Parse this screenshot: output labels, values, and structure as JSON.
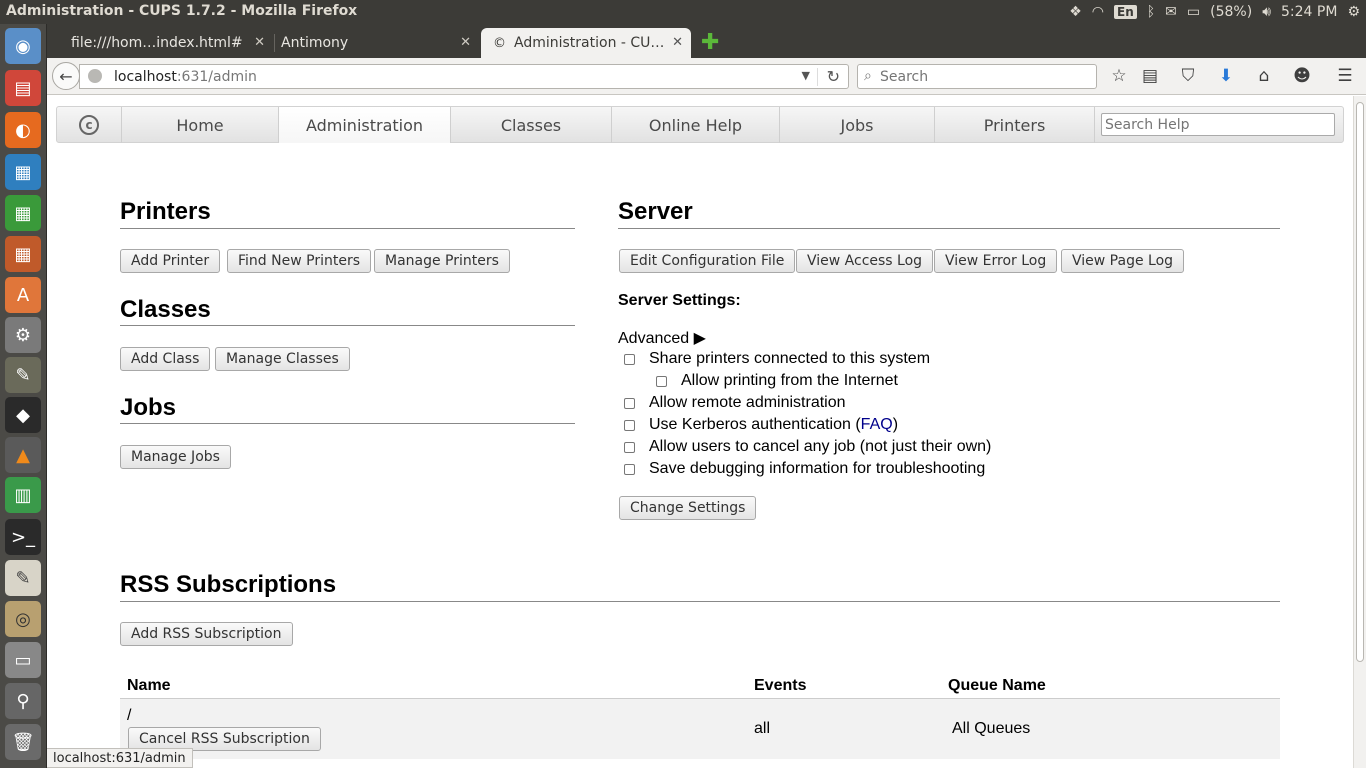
{
  "window": {
    "title": "Administration - CUPS 1.7.2 - Mozilla Firefox"
  },
  "tray": {
    "keyboard": "En",
    "battery": "(58%)",
    "clock": "5:24 PM"
  },
  "tabs": [
    {
      "label": "file:///hom…index.html#"
    },
    {
      "label": "Antimony"
    },
    {
      "label": "Administration - CU…"
    }
  ],
  "navbar": {
    "url_host": "localhost",
    "url_rest": ":631/admin",
    "search_placeholder": "Search"
  },
  "cups_nav": {
    "items": [
      "Home",
      "Administration",
      "Classes",
      "Online Help",
      "Jobs",
      "Printers"
    ],
    "search_placeholder": "Search Help"
  },
  "printers": {
    "heading": "Printers",
    "buttons": [
      "Add Printer",
      "Find New Printers",
      "Manage Printers"
    ]
  },
  "classes": {
    "heading": "Classes",
    "buttons": [
      "Add Class",
      "Manage Classes"
    ]
  },
  "jobs": {
    "heading": "Jobs",
    "buttons": [
      "Manage Jobs"
    ]
  },
  "server": {
    "heading": "Server",
    "buttons": [
      "Edit Configuration File",
      "View Access Log",
      "View Error Log",
      "View Page Log"
    ],
    "settings_label": "Server Settings:",
    "advanced_link": "Advanced ▶",
    "options": {
      "share": "Share printers connected to this system",
      "internet": "Allow printing from the Internet",
      "remote_admin": "Allow remote administration",
      "kerberos_pre": "Use Kerberos authentication (",
      "kerberos_link": "FAQ",
      "kerberos_post": ")",
      "cancel_any": "Allow users to cancel any job (not just their own)",
      "debug": "Save debugging information for troubleshooting"
    },
    "change_button": "Change Settings"
  },
  "rss": {
    "heading": "RSS Subscriptions",
    "add_button": "Add RSS Subscription",
    "columns": [
      "Name",
      "Events",
      "Queue Name"
    ],
    "rows": [
      {
        "name": "/",
        "cancel_button": "Cancel RSS Subscription",
        "events": "all",
        "queue": "All Queues"
      }
    ]
  },
  "status_url": "localhost:631/admin"
}
